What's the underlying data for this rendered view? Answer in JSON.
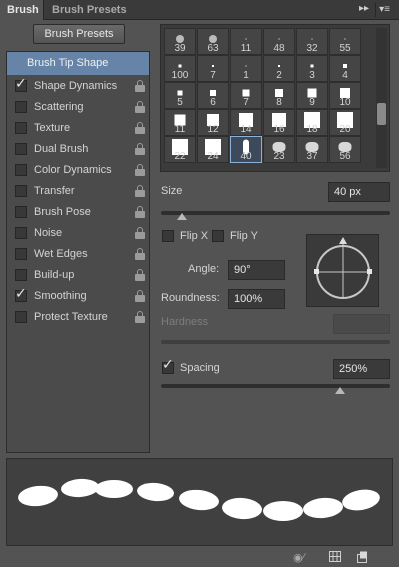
{
  "tabs": {
    "active": "Brush",
    "inactive": "Brush Presets"
  },
  "tabbar_icons": {
    "collapse": "double-arrow-icon",
    "menu": "panel-menu-icon"
  },
  "brush_presets_button": "Brush Presets",
  "left_panel": {
    "header": "Brush Tip Shape",
    "items": [
      {
        "label": "Shape Dynamics",
        "checked": true
      },
      {
        "label": "Scattering",
        "checked": false
      },
      {
        "label": "Texture",
        "checked": false
      },
      {
        "label": "Dual Brush",
        "checked": false
      },
      {
        "label": "Color Dynamics",
        "checked": false
      },
      {
        "label": "Transfer",
        "checked": false
      },
      {
        "label": "Brush Pose",
        "checked": false
      },
      {
        "label": "Noise",
        "checked": false
      },
      {
        "label": "Wet Edges",
        "checked": false
      },
      {
        "label": "Build-up",
        "checked": false
      },
      {
        "label": "Smoothing",
        "checked": true
      },
      {
        "label": "Protect Texture",
        "checked": false
      }
    ]
  },
  "brush_grid": {
    "rows": [
      [
        "39",
        "63",
        "11",
        "48",
        "32",
        "55"
      ],
      [
        "100",
        "7",
        "1",
        "2",
        "3",
        "4"
      ],
      [
        "5",
        "6",
        "7",
        "8",
        "9",
        "10"
      ],
      [
        "11",
        "12",
        "14",
        "16",
        "18",
        "20"
      ],
      [
        "22",
        "24",
        "40",
        "23",
        "37",
        "56"
      ]
    ],
    "selected": "40"
  },
  "size": {
    "label": "Size",
    "value": "40 px",
    "level_percent": 9
  },
  "flip_x": {
    "label": "Flip X",
    "checked": false
  },
  "flip_y": {
    "label": "Flip Y",
    "checked": false
  },
  "angle": {
    "label": "Angle:",
    "value": "90°"
  },
  "roundness": {
    "label": "Roundness:",
    "value": "100%"
  },
  "hardness": {
    "label": "Hardness"
  },
  "spacing": {
    "label": "Spacing",
    "checked": true,
    "value": "250%",
    "level_percent": 78
  },
  "colors": {
    "selection": "#6584a8",
    "panel": "#535353",
    "field": "#3a3a3a"
  }
}
